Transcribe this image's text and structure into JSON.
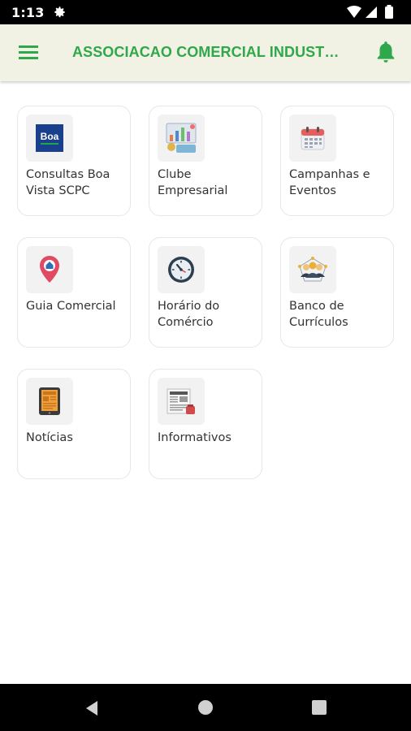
{
  "status_bar": {
    "time": "1:13"
  },
  "app_bar": {
    "title": "ASSOCIACAO COMERCIAL INDUSTRIAL"
  },
  "tiles": [
    {
      "label": "Consultas Boa Vista SCPC",
      "icon": "boa-vista-logo-icon",
      "icon_text": "Boa"
    },
    {
      "label": "Clube Empresarial",
      "icon": "business-club-icon"
    },
    {
      "label": "Campanhas e Eventos",
      "icon": "calendar-icon"
    },
    {
      "label": "Guia Comercial",
      "icon": "map-pin-icon"
    },
    {
      "label": "Horário do Comércio",
      "icon": "clock-icon"
    },
    {
      "label": "Banco de Currículos",
      "icon": "people-network-icon"
    },
    {
      "label": "Notícias",
      "icon": "tablet-news-icon"
    },
    {
      "label": "Informativos",
      "icon": "newspaper-icon"
    }
  ],
  "colors": {
    "accent": "#2ea84a",
    "appbar_bg": "#f1f1e4"
  }
}
